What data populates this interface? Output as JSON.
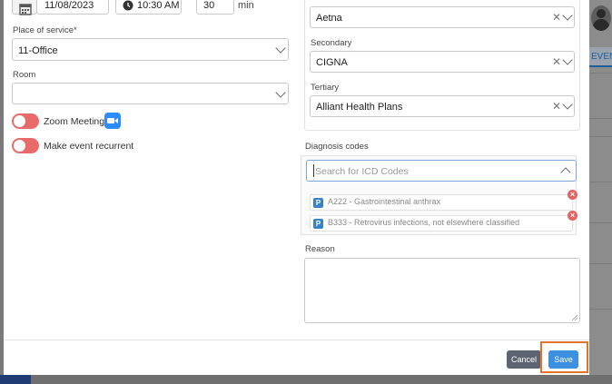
{
  "appointment": {
    "date": "11/08/2023",
    "time": "10:30 AM",
    "duration": "30",
    "duration_unit": "min"
  },
  "place_of_service": {
    "label": "Place of service*",
    "value": "11-Office"
  },
  "room": {
    "label": "Room",
    "value": ""
  },
  "zoom_meeting": {
    "label": "Zoom Meeting",
    "enabled": false
  },
  "recurrent": {
    "label": "Make event recurrent",
    "enabled": false
  },
  "insurance": {
    "primary_value": "Aetna",
    "secondary_label": "Secondary",
    "secondary_value": "CIGNA",
    "tertiary_label": "Tertiary",
    "tertiary_value": "Alliant Health Plans"
  },
  "diagnosis": {
    "label": "Diagnosis codes",
    "search_placeholder": "Search for ICD Codes",
    "codes": [
      {
        "badge": "P",
        "text": "A222 - Gastrointestinal anthrax"
      },
      {
        "badge": "P",
        "text": "B333 - Retrovirus infections, not elsewhere classified"
      }
    ]
  },
  "reason": {
    "label": "Reason",
    "value": ""
  },
  "footer": {
    "cancel_label": "Cancel",
    "save_label": "Save"
  },
  "background": {
    "event_tab_label": "EVENT"
  },
  "colors": {
    "toggle_off": "#e86a6a",
    "save_button": "#3d90e0",
    "cancel_button": "#5b6470",
    "highlight": "#e0742d",
    "zoom_brand": "#2d8cff"
  }
}
